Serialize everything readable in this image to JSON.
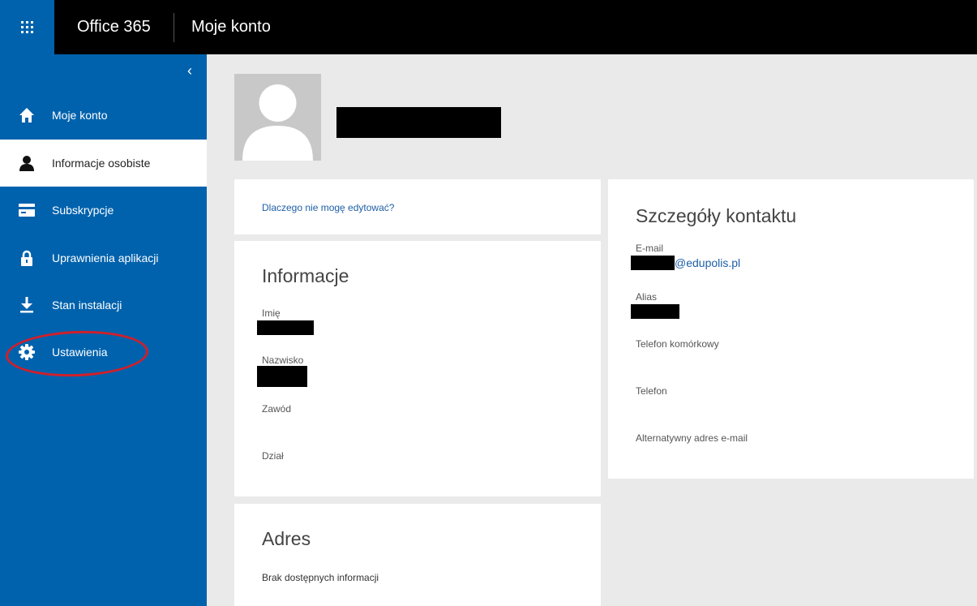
{
  "topbar": {
    "brand": "Office 365",
    "app_title": "Moje konto"
  },
  "icons": {
    "waffle": "app-launcher-icon",
    "collapse": "chevron-left-icon"
  },
  "sidebar": {
    "collapse_glyph": "‹",
    "items": [
      {
        "label": "Moje konto",
        "icon": "home-icon",
        "active": false
      },
      {
        "label": "Informacje osobiste",
        "icon": "person-icon",
        "active": true
      },
      {
        "label": "Subskrypcje",
        "icon": "card-icon",
        "active": false
      },
      {
        "label": "Uprawnienia aplikacji",
        "icon": "lock-icon",
        "active": false
      },
      {
        "label": "Stan instalacji",
        "icon": "download-icon",
        "active": false
      },
      {
        "label": "Ustawienia",
        "icon": "gear-icon",
        "active": false
      }
    ]
  },
  "edit_card": {
    "link": "Dlaczego nie mogę edytować?"
  },
  "info_card": {
    "title": "Informacje",
    "first_name_label": "Imię",
    "last_name_label": "Nazwisko",
    "job_label": "Zawód",
    "department_label": "Dział"
  },
  "address_card": {
    "title": "Adres",
    "empty_text": "Brak dostępnych informacji"
  },
  "contact_card": {
    "title": "Szczegóły kontaktu",
    "email_label": "E-mail",
    "email_domain": "@edupolis.pl",
    "alias_label": "Alias",
    "mobile_label": "Telefon komórkowy",
    "phone_label": "Telefon",
    "alt_email_label": "Alternatywny adres e-mail"
  },
  "colors": {
    "accent": "#0062ad",
    "topbar": "#000000",
    "link": "#1d5fa7",
    "highlight_ring": "#d11f2a"
  }
}
